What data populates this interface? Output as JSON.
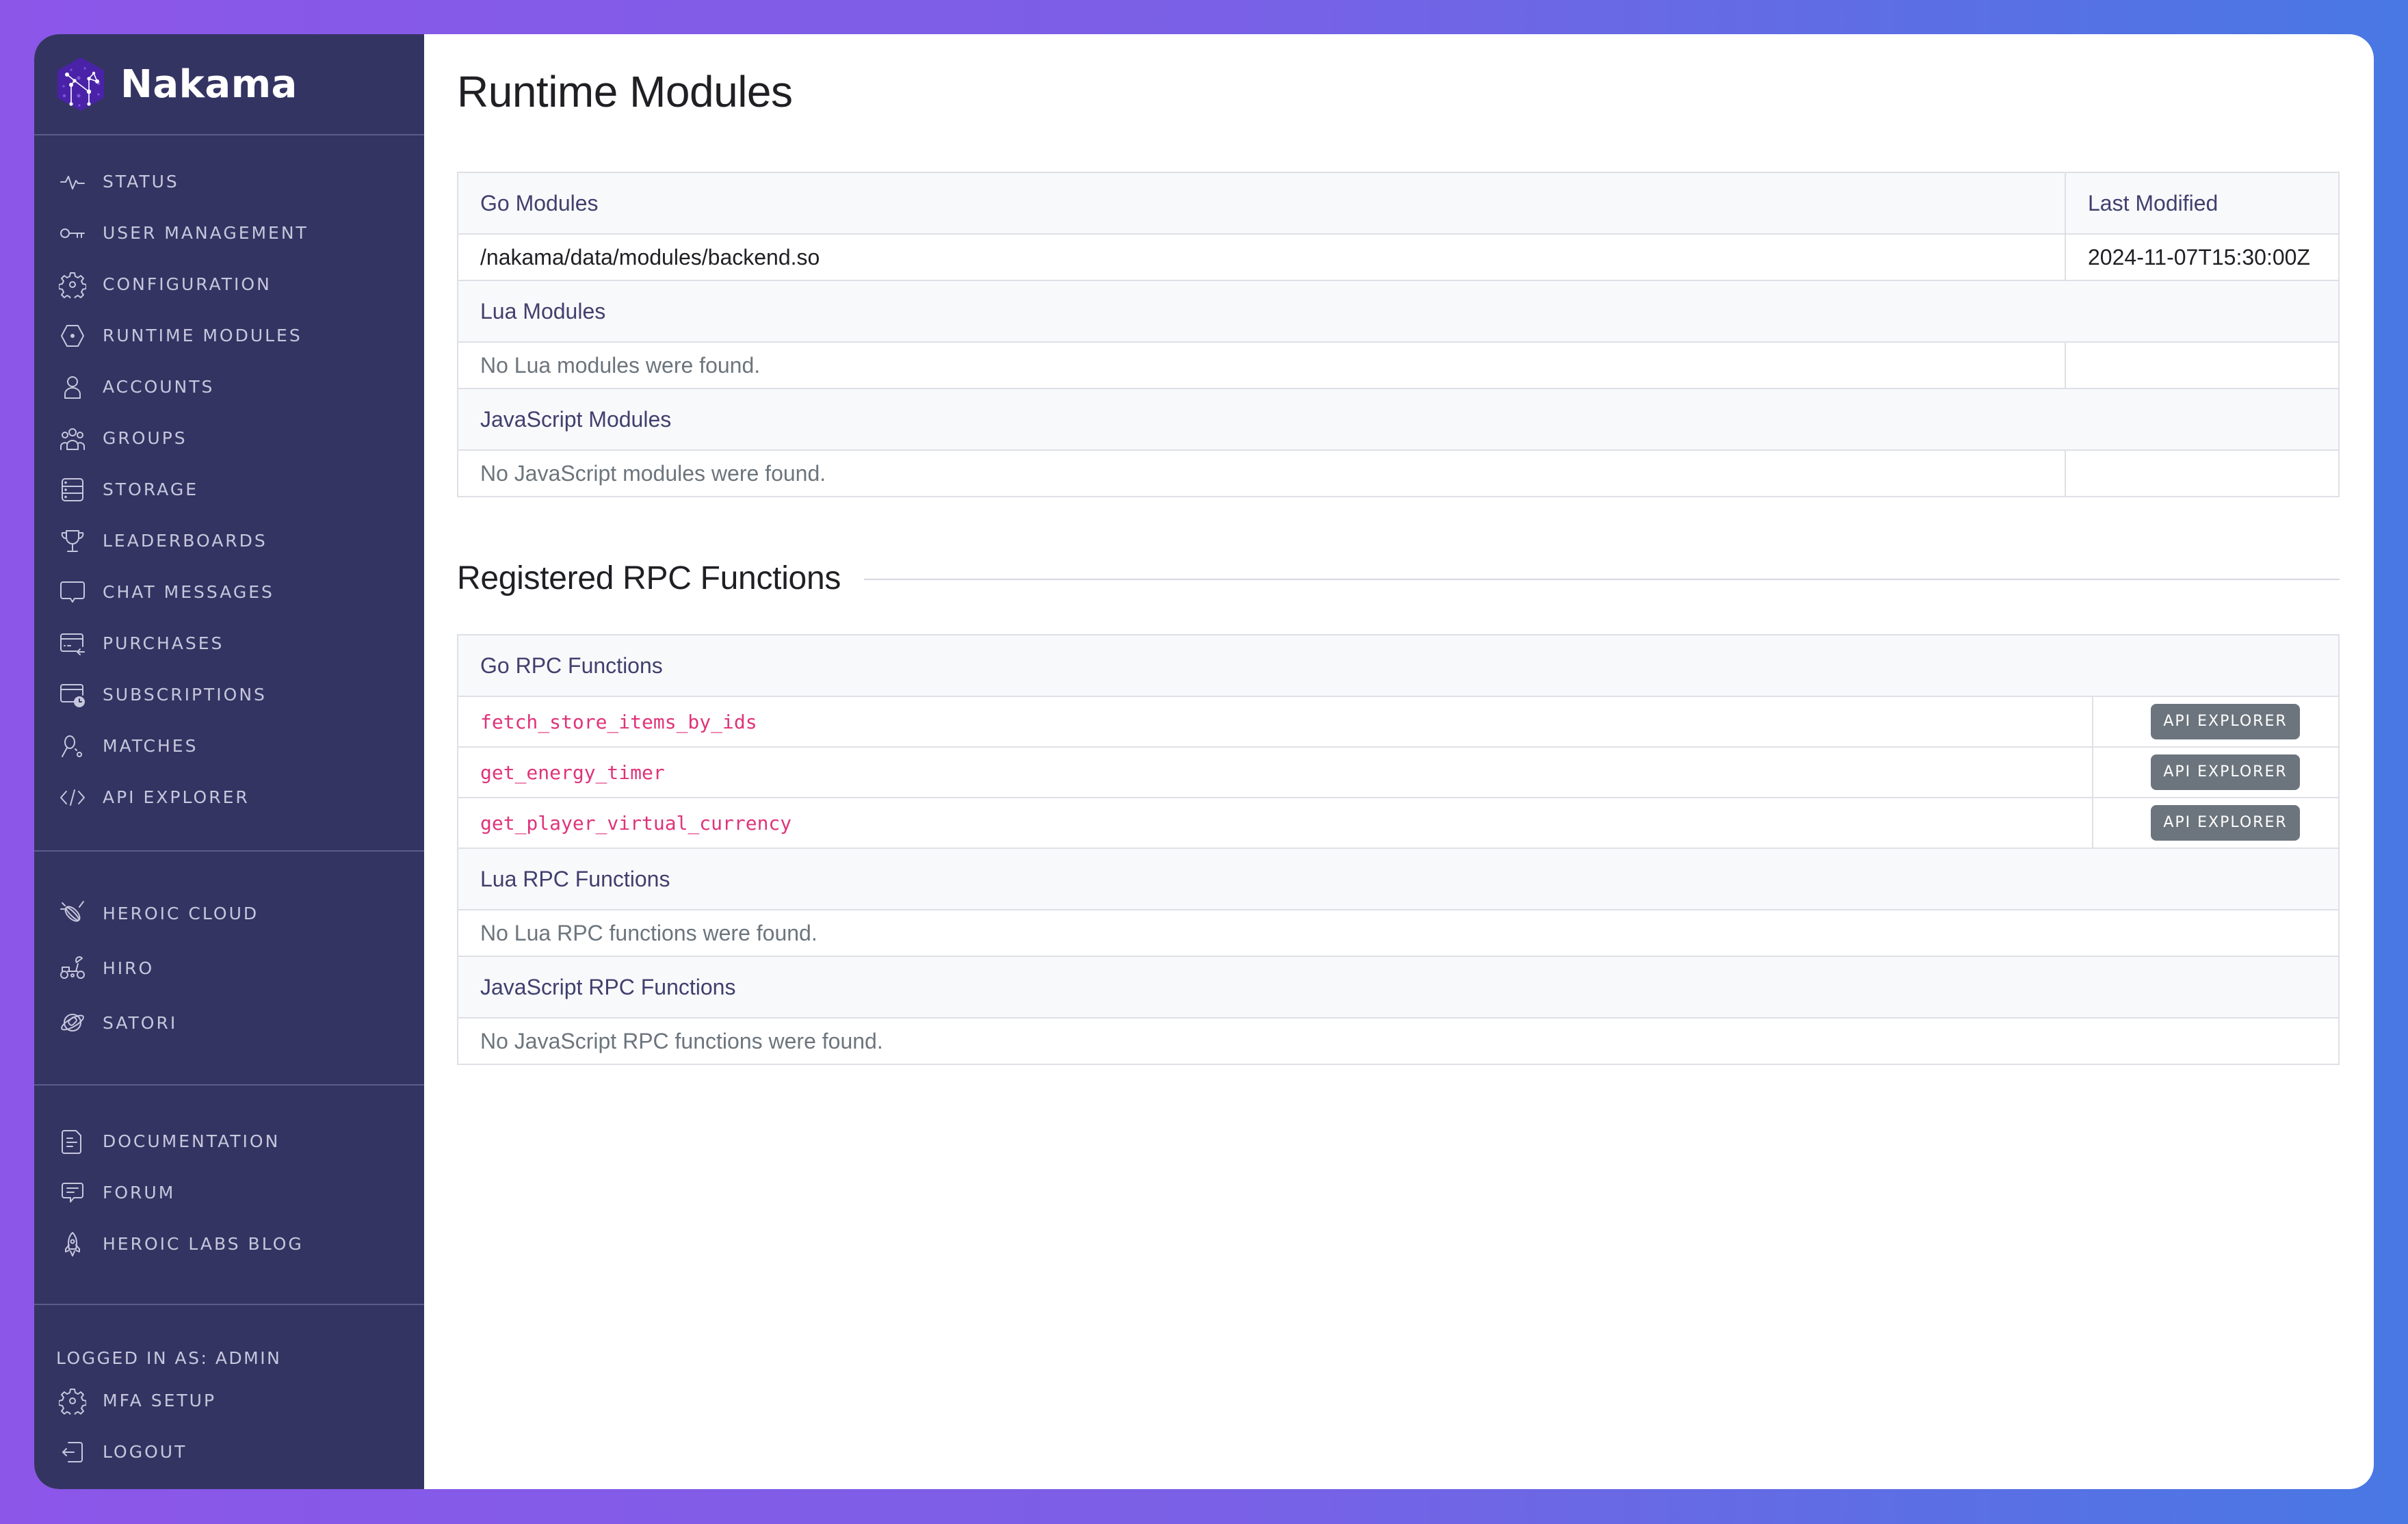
{
  "brand": {
    "name": "Nakama",
    "logo_icon": "nakama-constellation-logo"
  },
  "sidebar": {
    "primary": [
      {
        "label": "Status",
        "icon": "pulse-icon"
      },
      {
        "label": "User Management",
        "icon": "key-icon"
      },
      {
        "label": "Configuration",
        "icon": "gear-icon"
      },
      {
        "label": "Runtime Modules",
        "icon": "hexagon-icon"
      },
      {
        "label": "Accounts",
        "icon": "user-icon"
      },
      {
        "label": "Groups",
        "icon": "users-icon"
      },
      {
        "label": "Storage",
        "icon": "database-icon"
      },
      {
        "label": "Leaderboards",
        "icon": "trophy-icon"
      },
      {
        "label": "Chat Messages",
        "icon": "chat-bubble-icon"
      },
      {
        "label": "Purchases",
        "icon": "credit-card-icon"
      },
      {
        "label": "Subscriptions",
        "icon": "card-clock-icon"
      },
      {
        "label": "Matches",
        "icon": "racket-ball-icon"
      },
      {
        "label": "API Explorer",
        "icon": "code-icon"
      }
    ],
    "products": [
      {
        "label": "Heroic Cloud",
        "icon": "satellite-icon"
      },
      {
        "label": "Hiro",
        "icon": "rover-icon"
      },
      {
        "label": "Satori",
        "icon": "planet-rocket-icon"
      }
    ],
    "resources": [
      {
        "label": "Documentation",
        "icon": "document-icon"
      },
      {
        "label": "Forum",
        "icon": "forum-icon"
      },
      {
        "label": "Heroic Labs Blog",
        "icon": "rocket-icon"
      }
    ],
    "logged_in_as": "LOGGED IN AS: ADMIN",
    "account": [
      {
        "label": "MFA Setup",
        "icon": "gear-icon"
      },
      {
        "label": "Logout",
        "icon": "logout-icon"
      }
    ]
  },
  "main": {
    "title": "Runtime Modules",
    "modules_table": {
      "go_header": "Go Modules",
      "last_modified_header": "Last Modified",
      "go_rows": [
        {
          "path": "/nakama/data/modules/backend.so",
          "last_modified": "2024-11-07T15:30:00Z"
        }
      ],
      "lua_header": "Lua Modules",
      "lua_empty": "No Lua modules were found.",
      "js_header": "JavaScript Modules",
      "js_empty": "No JavaScript modules were found."
    },
    "rpc": {
      "heading": "Registered RPC Functions",
      "go_header": "Go RPC Functions",
      "go_functions": [
        {
          "name": "fetch_store_items_by_ids",
          "button": "API EXPLORER"
        },
        {
          "name": "get_energy_timer",
          "button": "API EXPLORER"
        },
        {
          "name": "get_player_virtual_currency",
          "button": "API EXPLORER"
        }
      ],
      "lua_header": "Lua RPC Functions",
      "lua_empty": "No Lua RPC functions were found.",
      "js_header": "JavaScript RPC Functions",
      "js_empty": "No JavaScript RPC functions were found."
    }
  },
  "colors": {
    "sidebar_bg": "#343463",
    "sidebar_text": "#c6c7dc",
    "section_header_text": "#40406e",
    "rpc_name": "#e0337a",
    "button_bg": "#6c757d",
    "gradient_start": "#8c56e9",
    "gradient_end": "#4878e3"
  }
}
